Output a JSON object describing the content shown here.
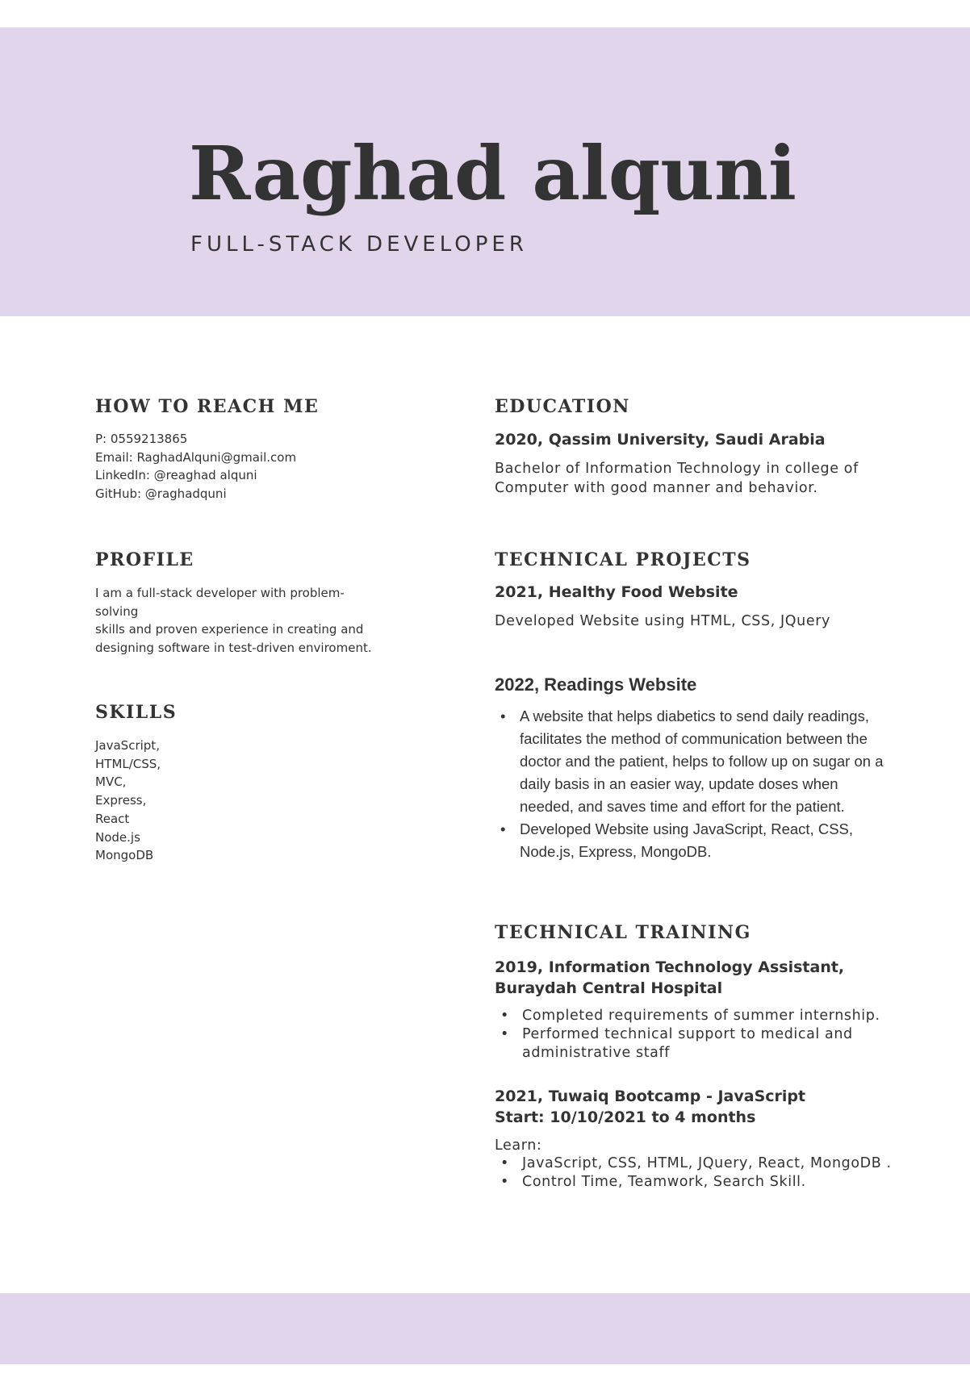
{
  "header": {
    "name": "Raghad alquni",
    "role": "FULL-STACK DEVELOPER"
  },
  "contact": {
    "heading": "HOW TO REACH ME",
    "phone": "P: 0559213865",
    "email": "Email: RaghadAlquni@gmail.com",
    "linkedin": "LinkedIn: @reaghad alquni",
    "github": "GitHub: @raghadquni"
  },
  "profile": {
    "heading": "PROFILE",
    "lines": [
      "I am a full-stack developer with problem-",
      "solving",
      "skills and proven experience in creating and",
      "designing software in test-driven enviroment."
    ]
  },
  "skills": {
    "heading": "SKILLS",
    "items": [
      "JavaScript,",
      "HTML/CSS,",
      "MVC,",
      "Express,",
      "React",
      "Node.js",
      "MongoDB"
    ]
  },
  "education": {
    "heading": "EDUCATION",
    "title": "2020, Qassim University, Saudi Arabia",
    "lines": [
      "Bachelor of Information Technology in college of",
      "Computer with good manner and behavior."
    ]
  },
  "projects": {
    "heading": "TECHNICAL PROJECTS",
    "p1_title": "2021, Healthy Food Website",
    "p1_desc": "Developed Website using HTML, CSS, JQuery",
    "p2_title": "2022, Readings Website",
    "p2_bullets": [
      "A website that helps diabetics to send daily readings, facilitates the method of communication between the doctor and the patient, helps to follow up on sugar on a daily basis in an easier way, update doses when needed, and saves time and effort for the patient.",
      "Developed Website using JavaScript, React, CSS, Node.js, Express, MongoDB."
    ]
  },
  "training": {
    "heading": "TECHNICAL TRAINING",
    "t1_title_1": "2019, Information Technology Assistant,",
    "t1_title_2": "Buraydah Central Hospital",
    "t1_bullets": [
      "Completed requirements of summer internship.",
      "Performed technical support to medical and administrative staff"
    ],
    "t2_title_1": "2021, Tuwaiq Bootcamp - JavaScript",
    "t2_title_2": "Start: 10/10/2021 to 4 months",
    "learn": "Learn:",
    "t2_bullets": [
      "JavaScript, CSS, HTML, JQuery, React, MongoDB .",
      "Control Time, Teamwork, Search Skill."
    ]
  }
}
